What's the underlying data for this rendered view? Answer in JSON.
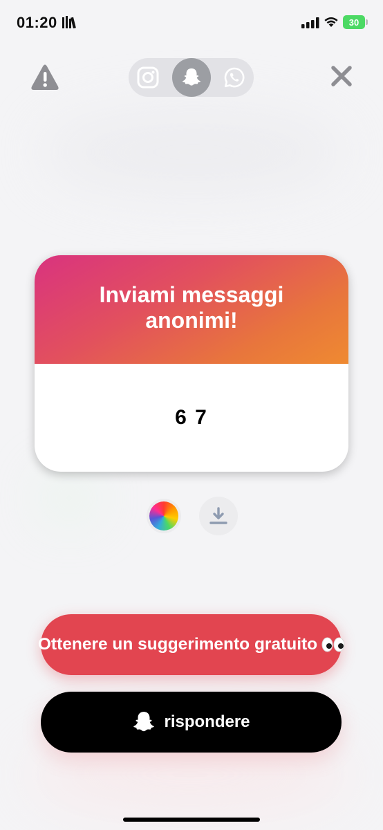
{
  "status_bar": {
    "time": "01:20",
    "battery": "30"
  },
  "toolbar": {
    "warning_icon": "warning-triangle-icon",
    "close_icon": "close-x-icon",
    "platforms": [
      {
        "name": "instagram",
        "icon": "instagram-icon",
        "selected": false
      },
      {
        "name": "snapchat",
        "icon": "snapchat-ghost-icon",
        "selected": true
      },
      {
        "name": "whatsapp",
        "icon": "whatsapp-icon",
        "selected": false
      }
    ]
  },
  "card": {
    "title": "Inviami messaggi anonimi!",
    "message": "6 7",
    "gradient_colors": [
      "#d9337f",
      "#e2505e",
      "#e8763c",
      "#ef8a31"
    ]
  },
  "actions": {
    "color_icon": "color-wheel-icon",
    "download_icon": "download-icon"
  },
  "buttons": {
    "hint_label": "Ottenere un suggerimento gratuito",
    "hint_color": "#e24550",
    "reply_label": "rispondere",
    "reply_color": "#000000"
  }
}
